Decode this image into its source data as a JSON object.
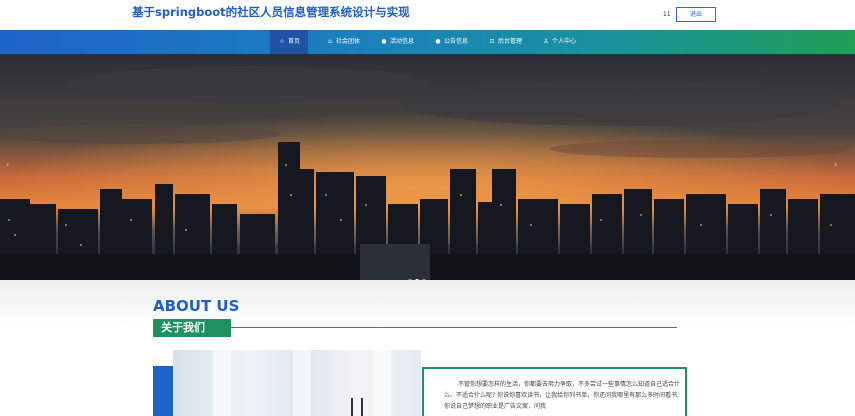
{
  "header": {
    "title": "基于springboot的社区人员信息管理系统设计与实现",
    "user": "11",
    "logout_label": "退出"
  },
  "nav": {
    "items": [
      {
        "label": "首页",
        "icon": "star-icon",
        "active": true
      },
      {
        "label": "社会团体",
        "icon": "home-icon"
      },
      {
        "label": "活动信息",
        "icon": "circle-icon"
      },
      {
        "label": "公告信息",
        "icon": "circle-icon"
      },
      {
        "label": "后台管理",
        "icon": "dashboard-icon"
      },
      {
        "label": "个人中心",
        "icon": "person-icon"
      }
    ]
  },
  "carousel": {
    "prev_icon": "chevron-left-icon",
    "next_icon": "chevron-right-icon",
    "slides": 3,
    "active_slide": 1
  },
  "about": {
    "heading_en": "ABOUT US",
    "heading_cn": "关于我们",
    "body": "不管你想要怎样的生活，你都要去努力争取，不多尝试一些事情怎么知道自己适合什么、不适合什么呢? 你说你喜欢读书，让我给你列书单，你还问我哪里有那么多时间看书;你说自己梦想的职业是广告文案，问我"
  },
  "colors": {
    "brand_blue": "#1f5fc6",
    "brand_green": "#1f9160"
  }
}
